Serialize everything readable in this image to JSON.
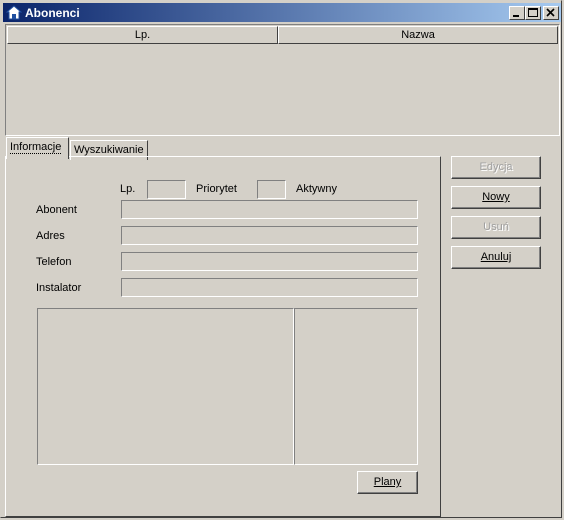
{
  "window": {
    "title": "Abonenci"
  },
  "titlebar_buttons": {
    "minimize": "minimize-icon",
    "maximize": "maximize-icon",
    "close": "close-icon"
  },
  "list": {
    "columns": [
      "Lp.",
      "Nazwa"
    ]
  },
  "tabs": [
    {
      "label": "Informacje",
      "active": true
    },
    {
      "label": "Wyszukiwanie",
      "active": false
    }
  ],
  "form": {
    "lp_label": "Lp.",
    "lp_value": "",
    "priorytet_label": "Priorytet",
    "priorytet_value": "",
    "aktywny_label": "Aktywny",
    "abonent_label": "Abonent",
    "abonent_value": "",
    "adres_label": "Adres",
    "adres_value": "",
    "telefon_label": "Telefon",
    "telefon_value": "",
    "instalator_label": "Instalator",
    "instalator_value": ""
  },
  "buttons": {
    "edycja": "Edycja",
    "nowy": "Nowy",
    "usun": "Usuń",
    "anuluj": "Anuluj",
    "plany": "Plany"
  }
}
